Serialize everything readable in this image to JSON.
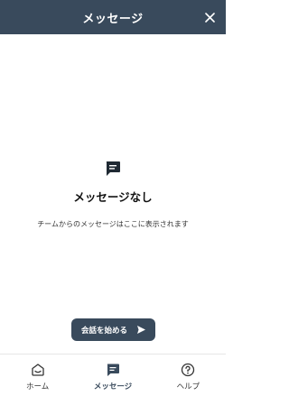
{
  "header": {
    "title": "メッセージ"
  },
  "empty_state": {
    "icon": "chat-bubble-icon",
    "title": "メッセージなし",
    "description": "チームからのメッセージはここに表示されます"
  },
  "start_button": {
    "label": "会話を始める",
    "icon": "send-icon"
  },
  "nav": {
    "items": [
      {
        "label": "ホーム",
        "icon": "home-icon",
        "active": false
      },
      {
        "label": "メッセージ",
        "icon": "messages-icon",
        "active": true
      },
      {
        "label": "ヘルプ",
        "icon": "help-icon",
        "active": false
      }
    ]
  },
  "colors": {
    "header_bg": "#394a5c",
    "button_bg": "#394a5c",
    "text_dark": "#111111"
  }
}
